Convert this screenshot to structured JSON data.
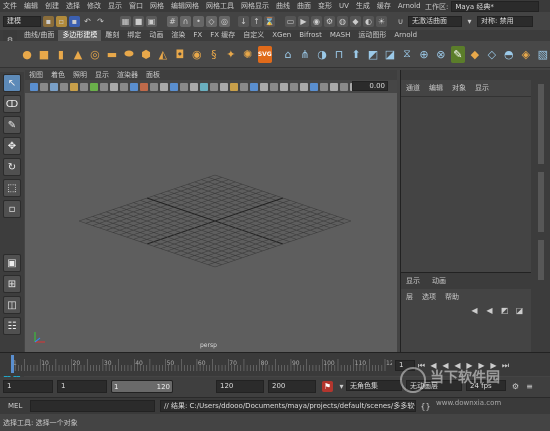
{
  "menubar": {
    "items": [
      "文件",
      "编辑",
      "创建",
      "选择",
      "修改",
      "显示",
      "窗口",
      "网格",
      "编辑网格",
      "网格工具",
      "网格显示",
      "曲线",
      "曲面",
      "变形",
      "UV",
      "生成",
      "缓存",
      "Arnold"
    ],
    "workspace_label": "工作区:",
    "workspace_value": "Maya 经典*"
  },
  "statusline": {
    "mode": "建模",
    "no_live_surface": "无激活曲面",
    "symmetry": "对称: 禁用"
  },
  "shelf_tabs": [
    {
      "label": "曲线/曲面"
    },
    {
      "label": "多边形建模",
      "active": true
    },
    {
      "label": "雕刻"
    },
    {
      "label": "绑定"
    },
    {
      "label": "动画"
    },
    {
      "label": "渲染"
    },
    {
      "label": "FX"
    },
    {
      "label": "FX 缓存"
    },
    {
      "label": "自定义"
    },
    {
      "label": "XGen"
    },
    {
      "label": "Bifrost"
    },
    {
      "label": "MASH"
    },
    {
      "label": "运动图形"
    },
    {
      "label": "Arnold"
    }
  ],
  "shelf_icons": [
    "sphere-icon",
    "cube-icon",
    "cylinder-icon",
    "cone-icon",
    "torus-icon",
    "plane-icon",
    "disc-icon",
    "platonic-icon",
    "pyramid-icon",
    "pipe-icon",
    "sphere-icon",
    "cube-icon",
    "star-icon",
    "sphere-icon",
    "svg-icon",
    "triangle-icon",
    "combine-icon",
    "separate-icon",
    "smooth-icon",
    "bridge-icon",
    "extrude-icon",
    "bevel-icon",
    "fill-icon",
    "mirror-icon",
    "target-weld-icon",
    "connect-icon",
    "cut-icon",
    "append-icon",
    "bool-icon",
    "reduce-icon"
  ],
  "shelf_svg_label": "SVG",
  "viewport": {
    "menu": [
      "视图",
      "着色",
      "照明",
      "显示",
      "渲染器",
      "面板"
    ],
    "camera_label": "persp",
    "field_value": "0.00"
  },
  "channel_box": {
    "tabs": [
      "通道",
      "编辑",
      "对象",
      "显示"
    ],
    "layer_tabs": [
      "显示",
      "动画"
    ],
    "layer_menu": [
      "层",
      "选项",
      "帮助"
    ]
  },
  "timeline": {
    "ticks": [
      "1",
      "10",
      "15",
      "20",
      "25",
      "30",
      "35",
      "40",
      "45",
      "50",
      "55",
      "60",
      "65",
      "70",
      "75",
      "80",
      "85",
      "90",
      "95",
      "100",
      "105",
      "110",
      "115",
      "120"
    ],
    "current_frame": "1"
  },
  "range": {
    "start": "1",
    "playback_start": "1",
    "range_start": "1",
    "range_end": "120",
    "playback_end": "120",
    "end": "200",
    "character_set": "无角色集",
    "anim_layer": "无动画层",
    "fps": "24 fps"
  },
  "cmdline": {
    "mel": "MEL",
    "result": "// 结果: C:/Users/ddooo/Documents/maya/projects/default/scenes/多多软件站.mb"
  },
  "helpline": {
    "text": "选择工具: 选择一个对象"
  },
  "watermark": {
    "brand": "当下软件园",
    "url": "www.downxia.com"
  }
}
